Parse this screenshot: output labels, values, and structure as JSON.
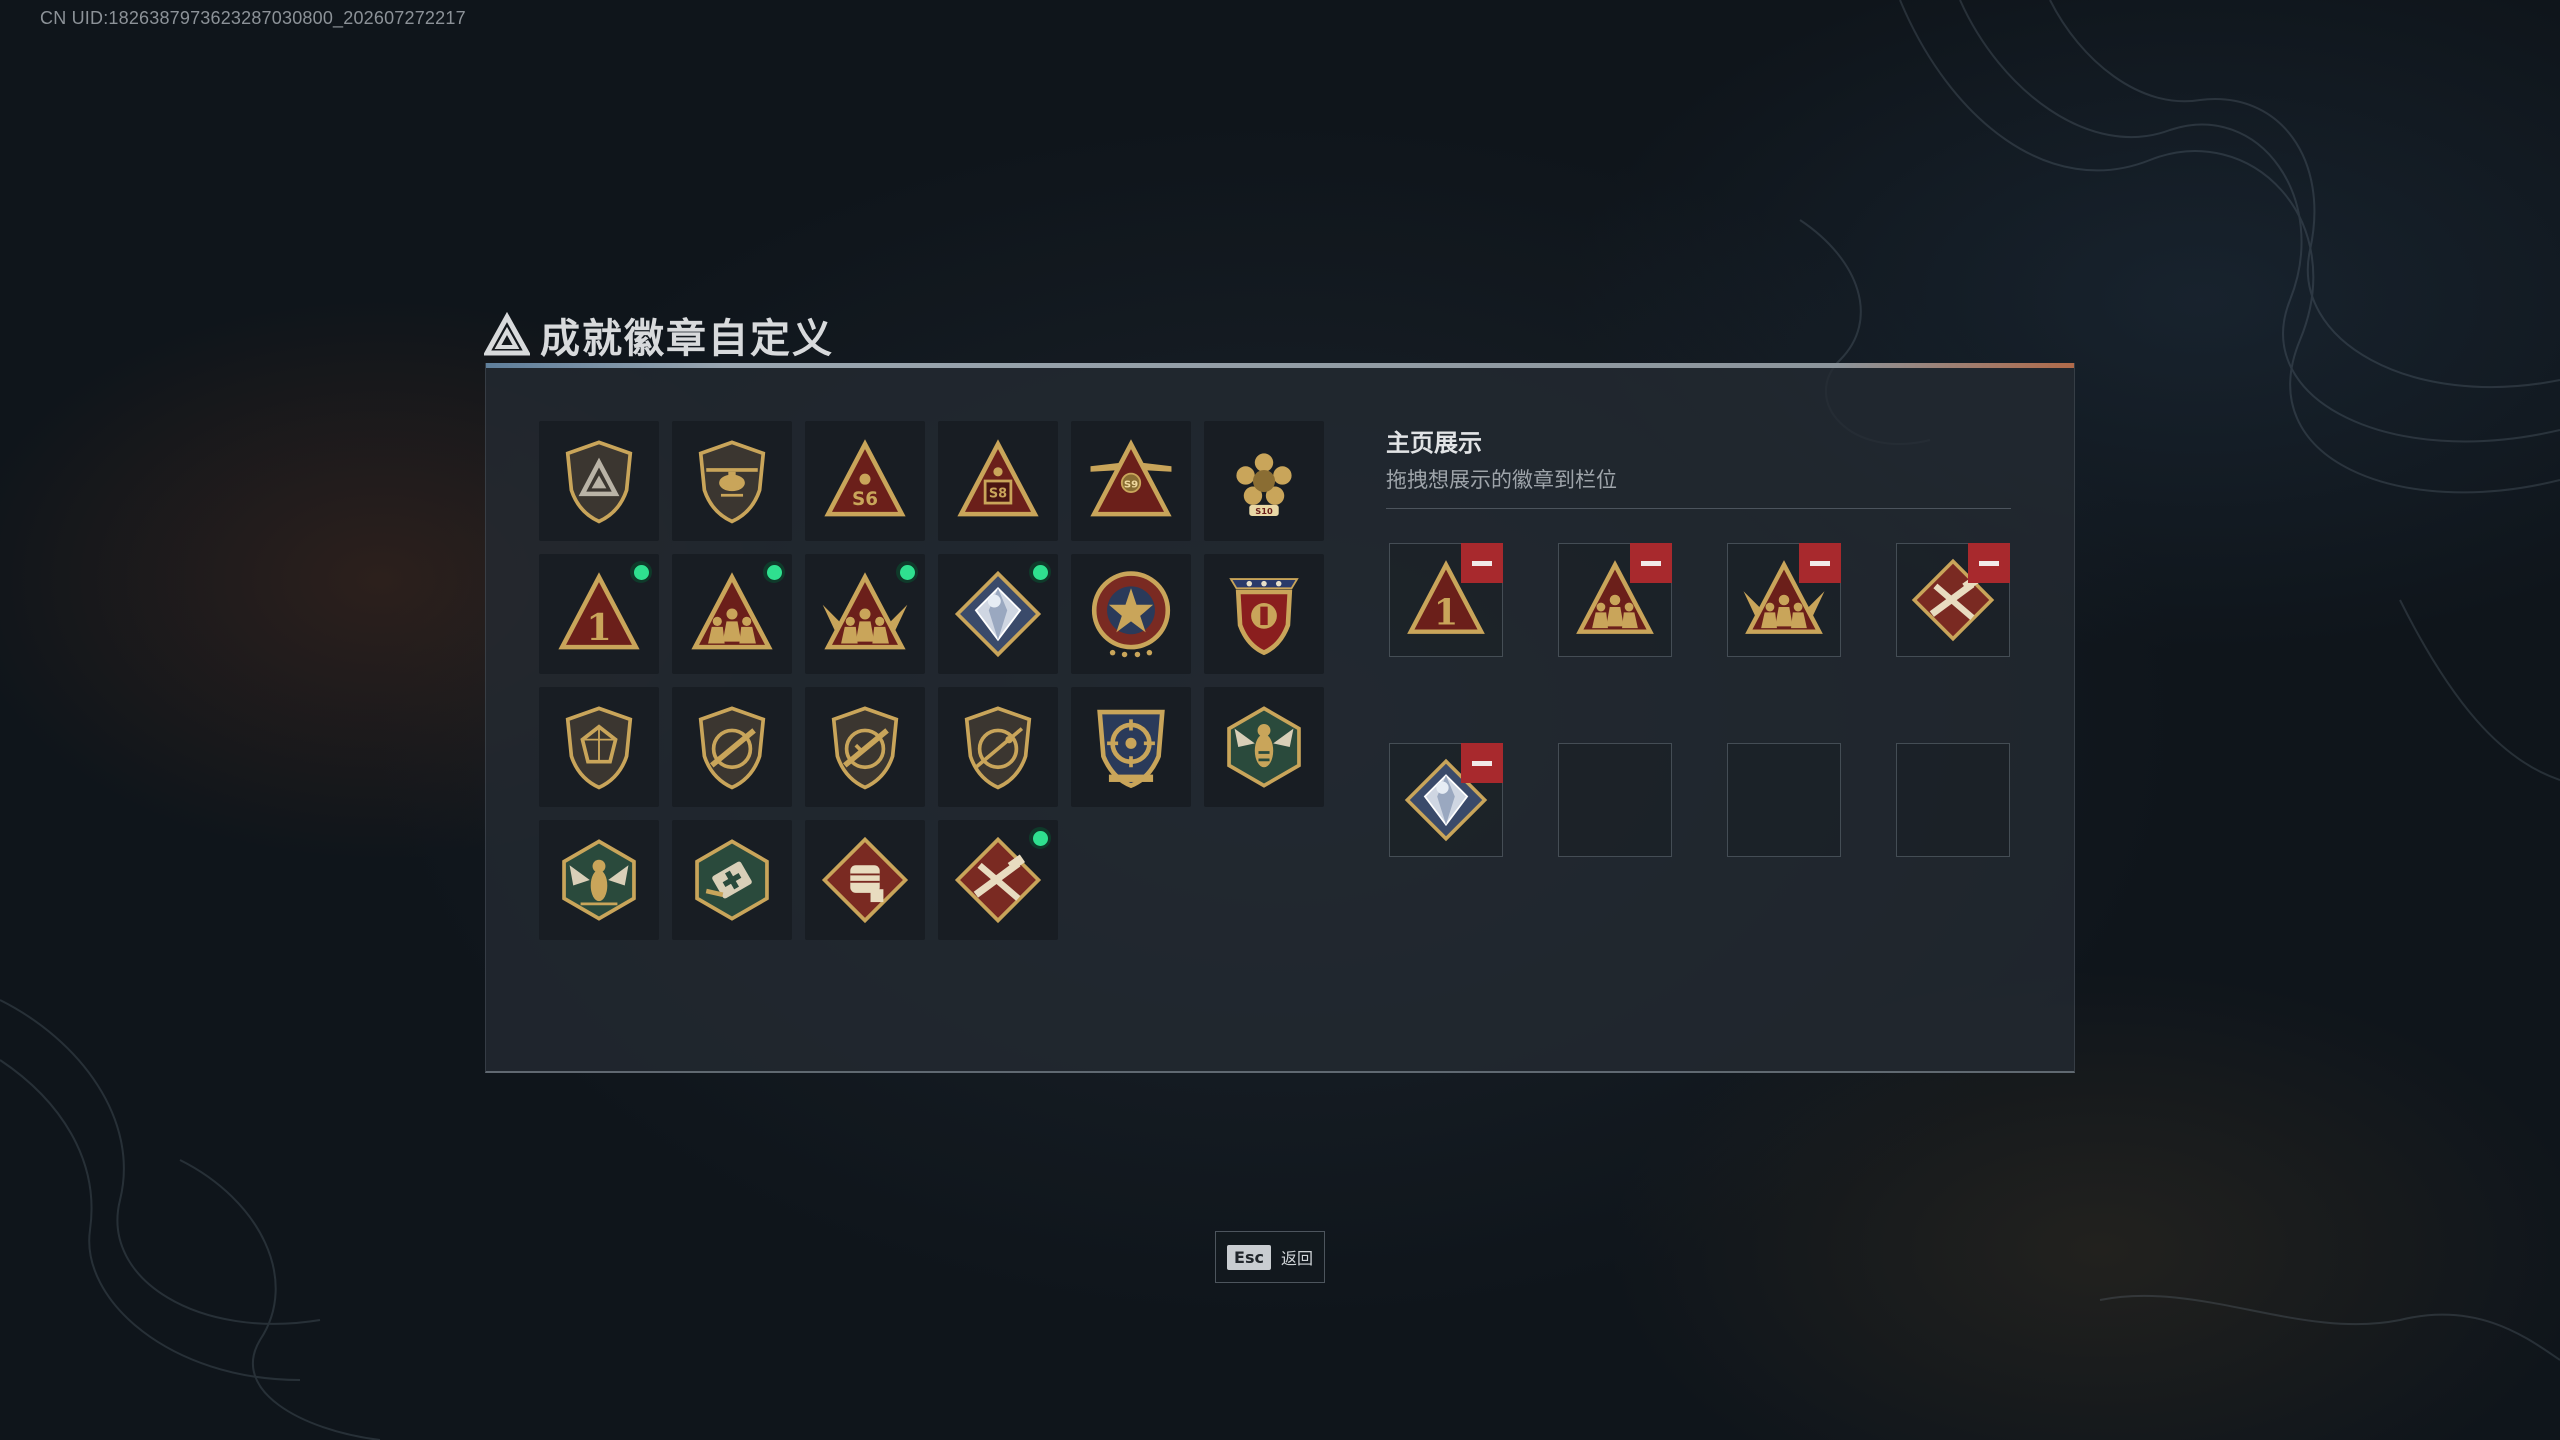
{
  "uid_text": "CN UID:1826387973623287030800_202607272217",
  "page": {
    "title": "成就徽章自定义",
    "title_icon": "triangle-logo-icon"
  },
  "badges": [
    {
      "icon": "shield-triangle-badge",
      "new": false
    },
    {
      "icon": "helicopter-shield-badge",
      "new": false
    },
    {
      "icon": "s6-triangle-badge",
      "new": false
    },
    {
      "icon": "s8-triangle-badge",
      "new": false
    },
    {
      "icon": "s9-winged-triangle-badge",
      "new": false
    },
    {
      "icon": "s10-laurel-badge",
      "new": false
    },
    {
      "icon": "rank-1-triangle-badge",
      "new": true
    },
    {
      "icon": "squad-triangle-badge",
      "new": true
    },
    {
      "icon": "elite-squad-triangle-badge",
      "new": true
    },
    {
      "icon": "crystal-diamond-badge",
      "new": true
    },
    {
      "icon": "star-medal-badge",
      "new": false
    },
    {
      "icon": "royal-crest-badge",
      "new": false
    },
    {
      "icon": "gem-shield-badge",
      "new": false
    },
    {
      "icon": "rifle-shield-badge",
      "new": false
    },
    {
      "icon": "rifle-shield-badge-2",
      "new": false
    },
    {
      "icon": "sniper-shield-badge",
      "new": false
    },
    {
      "icon": "target-crest-badge",
      "new": false
    },
    {
      "icon": "wasp-hexagon-badge",
      "new": false
    },
    {
      "icon": "wasp-hexagon-badge-2",
      "new": false
    },
    {
      "icon": "medkit-hexagon-badge",
      "new": false
    },
    {
      "icon": "fist-diamond-badge",
      "new": false
    },
    {
      "icon": "crossed-tools-diamond-badge",
      "new": true
    }
  ],
  "showcase": {
    "title": "主页展示",
    "subtitle": "拖拽想展示的徽章到栏位",
    "slots": [
      {
        "icon": "rank-1-triangle-badge",
        "filled": true
      },
      {
        "icon": "squad-triangle-badge",
        "filled": true
      },
      {
        "icon": "elite-squad-triangle-badge",
        "filled": true
      },
      {
        "icon": "crossed-tools-diamond-badge",
        "filled": true
      },
      {
        "icon": "crystal-diamond-badge",
        "filled": true
      },
      {
        "icon": "",
        "filled": false
      },
      {
        "icon": "",
        "filled": false
      },
      {
        "icon": "",
        "filled": false
      }
    ]
  },
  "footer": {
    "esc_key": "Esc",
    "esc_label": "返回"
  },
  "colors": {
    "gold": "#c9a55a",
    "dark_red": "#6b1f1a",
    "new_dot": "#2fe08f",
    "remove_red": "#a8292d",
    "hex_green": "#2a4a3c",
    "crystal_blue": "#3a4a6a"
  }
}
